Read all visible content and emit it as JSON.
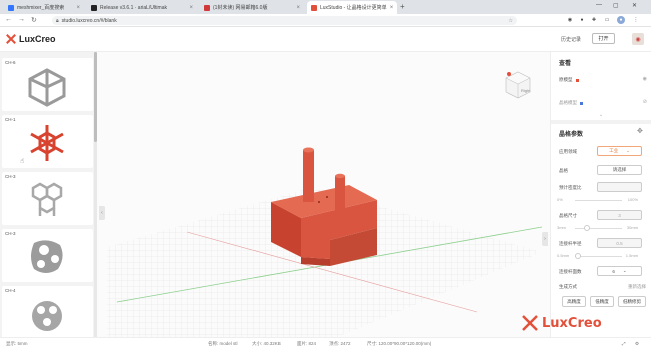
{
  "browser": {
    "tabs": [
      {
        "title": "meshmixer_百度搜索",
        "favicon_color": "#3377ff"
      },
      {
        "title": "Release v3.6.1 · ariaL/Ultimak",
        "favicon_color": "#222222"
      },
      {
        "title": "(1封未读) 网易邮箱6.0版",
        "favicon_color": "#d0383a"
      },
      {
        "title": "LuxStudio - 让晶格设计更简单",
        "favicon_color": "#e2503a"
      }
    ],
    "url": "studio.luxcreo.cn/#/blank"
  },
  "app": {
    "logo_text": "LuxCreo",
    "history_label": "历史记录",
    "open_label": "打开"
  },
  "models": [
    {
      "label": "CH-6"
    },
    {
      "label": "CH-1"
    },
    {
      "label": "CH-3"
    },
    {
      "label": "CH-3"
    },
    {
      "label": "CH-4"
    }
  ],
  "view_cube": {
    "face_label": "Right"
  },
  "right_panel": {
    "view_title": "查看",
    "layers": [
      {
        "label": "原模型",
        "color": "#e2503a"
      },
      {
        "label": "晶格模型",
        "color": "#4a78d8"
      }
    ],
    "lattice_title": "晶格参数",
    "application_label": "应用领域",
    "application_value": "工业",
    "lattice_label": "晶格",
    "lattice_value": "请选择",
    "density_label": "预计密度比",
    "density_min": "0%",
    "density_max": "100%",
    "size_label": "晶格尺寸",
    "size_value": "3",
    "size_min": "3mm",
    "size_max": "30mm",
    "strut_label": "连接杆半径",
    "strut_value": "0.5",
    "strut_min": "0.5mm",
    "strut_max": "1.5mm",
    "layer_label": "连接杆面数",
    "layer_value": "6",
    "gen_label": "生成方式",
    "gen_more": "重新选择",
    "buttons": [
      "高精度",
      "低精度",
      "低精修剪"
    ]
  },
  "statusbar": {
    "display": "显示: 5mm",
    "name": "名称: model stl",
    "size": "大小: 40.32KB",
    "faces": "面片: 824",
    "vertices": "顶点: 2472",
    "dims": "尺寸: 120.00*90.00*120.00(mm)"
  },
  "watermark": "LuxCreo",
  "colors": {
    "accent": "#e2503a",
    "model": "#d9553f"
  }
}
